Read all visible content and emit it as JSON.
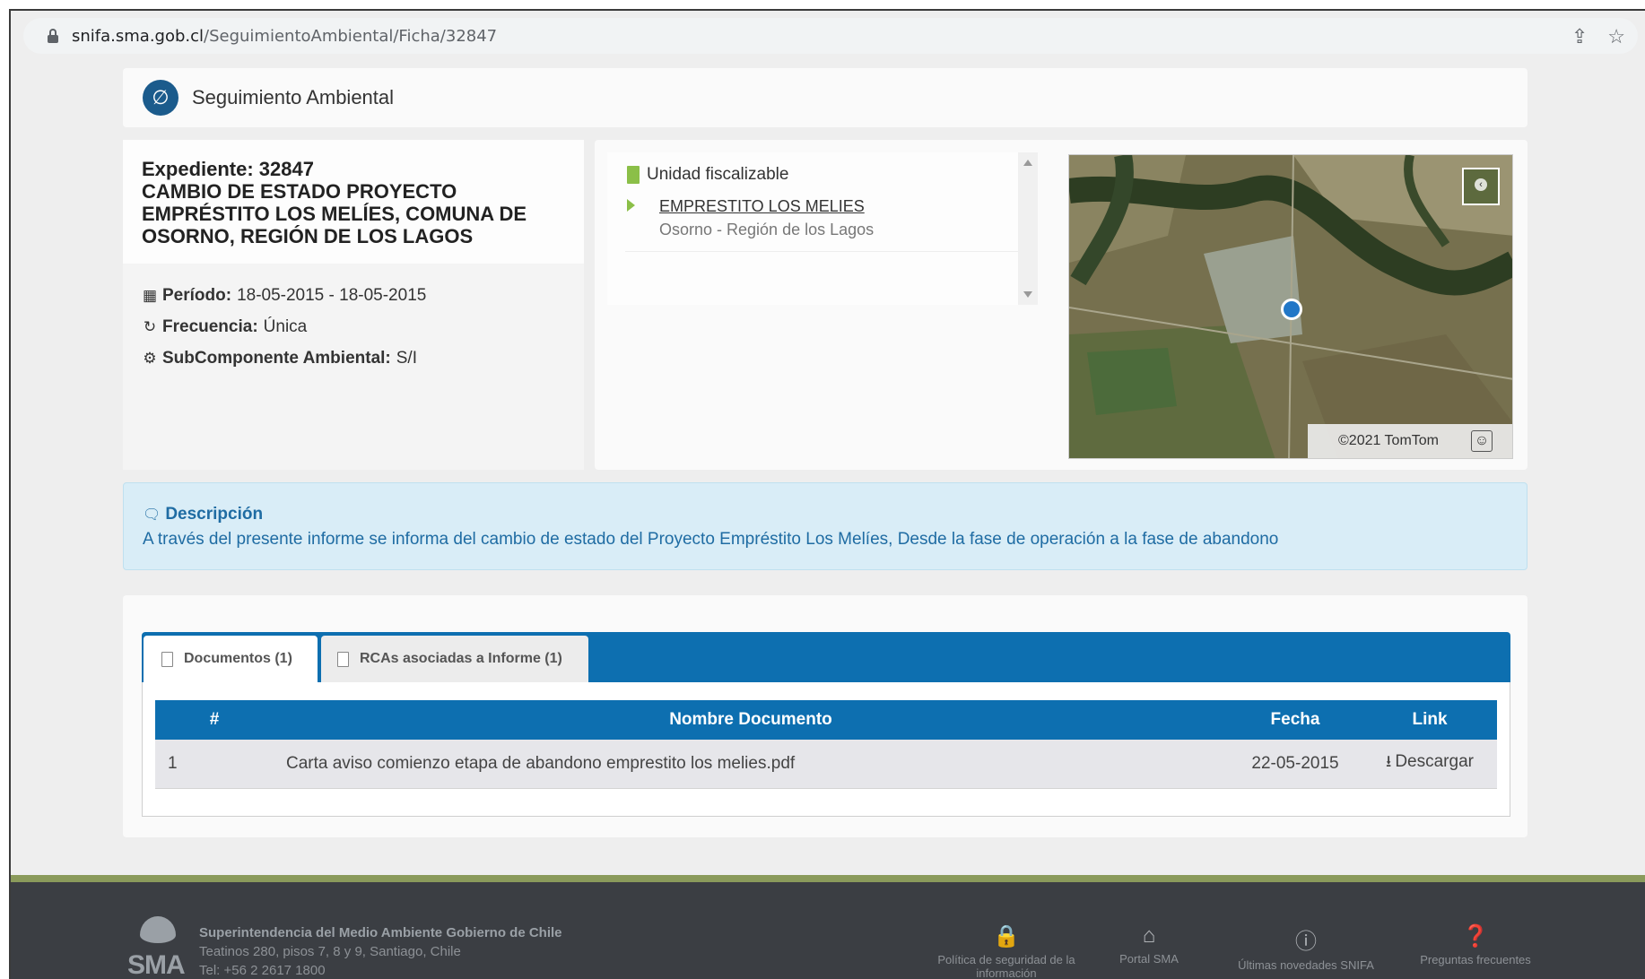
{
  "browser": {
    "url_host": "snifa.sma.gob.cl",
    "url_path": "/SeguimientoAmbiental/Ficha/32847",
    "share_icon": "share-icon",
    "star_icon": "star-icon"
  },
  "header": {
    "title": "Seguimiento Ambiental",
    "icon": "leaf-icon"
  },
  "expediente": {
    "title_line1": "Expediente: 32847",
    "title_line2": "CAMBIO DE ESTADO PROYECTO",
    "title_line3": "EMPRÉSTITO LOS MELÍES, COMUNA DE",
    "title_line4": "OSORNO, REGIÓN DE LOS LAGOS",
    "periodo_label": "Período:",
    "periodo_value": "18-05-2015 - 18-05-2015",
    "frecuencia_label": "Frecuencia:",
    "frecuencia_value": "Única",
    "subcomponente_label": "SubComponente Ambiental:",
    "subcomponente_value": "S/I"
  },
  "unidad": {
    "title": "Unidad fiscalizable",
    "item_name": "EMPRESTITO LOS MELIES",
    "item_location": "Osorno - Región de los Lagos"
  },
  "map": {
    "attribution": "©2021 TomTom"
  },
  "descripcion": {
    "title": "Descripción",
    "text": "A través del presente informe se informa del cambio de estado del Proyecto Empréstito Los Melíes, Desde la fase de operación a la fase de abandono"
  },
  "tabs": [
    {
      "label": "Documentos (1)",
      "active": true
    },
    {
      "label": "RCAs asociadas a Informe (1)",
      "active": false
    }
  ],
  "documents": {
    "columns": [
      "#",
      "Nombre Documento",
      "Fecha",
      "Link"
    ],
    "rows": [
      {
        "num": "1",
        "name": "Carta aviso comienzo etapa de abandono emprestito los melies.pdf",
        "fecha": "22-05-2015",
        "link": "Descargar"
      }
    ]
  },
  "footer": {
    "org": "Superintendencia del Medio Ambiente Gobierno de Chile",
    "address": "Teatinos 280, pisos 7, 8 y 9, Santiago, Chile",
    "phone": "Tel: +56 2 2617 1800",
    "logo_text": "SMA",
    "links": [
      {
        "label_line1": "Política de seguridad de la",
        "label_line2": "información",
        "icon": "lock-icon"
      },
      {
        "label_line1": "Portal SMA",
        "label_line2": "",
        "icon": "home-icon"
      },
      {
        "label_line1": "Últimas novedades SNIFA",
        "label_line2": "",
        "icon": "info-icon"
      },
      {
        "label_line1": "Preguntas frecuentes",
        "label_line2": "",
        "icon": "question-icon"
      }
    ]
  },
  "colors": {
    "primary_blue": "#0d6fb0",
    "desc_bg": "#d9edf7",
    "desc_text": "#1f6ca3",
    "accent_green": "#8bbf48",
    "footer_bg": "#3b3e43",
    "footer_stripe": "#8a9a5b"
  }
}
